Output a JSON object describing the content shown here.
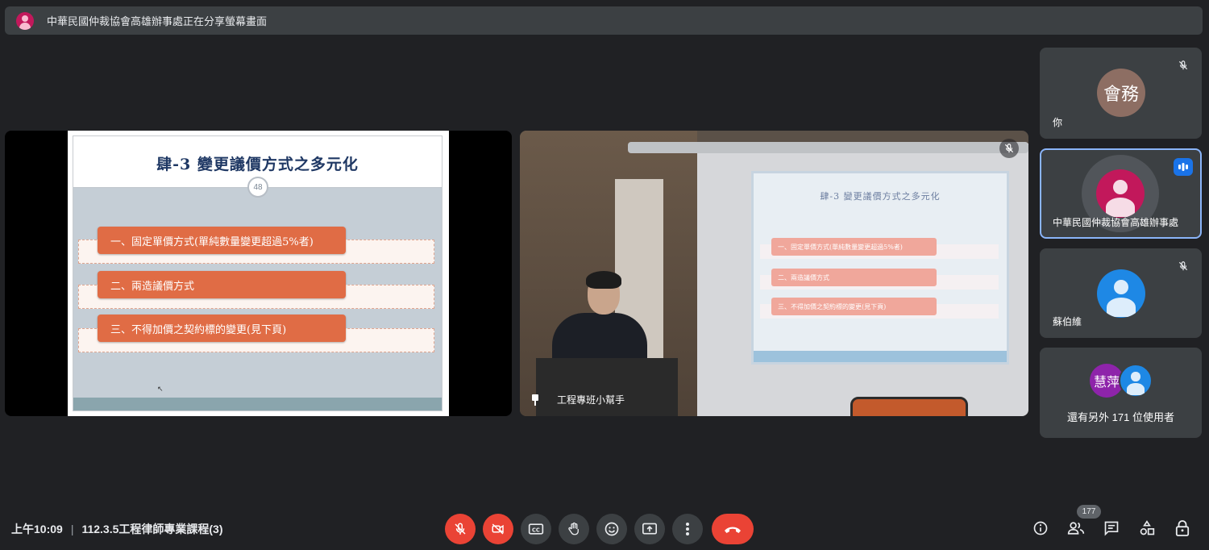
{
  "banner": {
    "text": "中華民國仲裁協會高雄辦事處正在分享螢幕畫面"
  },
  "presentation": {
    "title": "肆-3  變更議價方式之多元化",
    "page_number": "48",
    "items": [
      "一、固定單價方式(單純數量變更超過5%者)",
      "二、兩造議價方式",
      "三、不得加價之契約標的變更(見下頁)"
    ]
  },
  "camera": {
    "name": "工程專班小幫手",
    "projected_title": "肆-3  變更議價方式之多元化",
    "projected_items": [
      "一、固定單價方式(單純數量變更超過5%者)",
      "二、兩造議價方式",
      "三、不得加價之契約標的變更(見下頁)"
    ]
  },
  "participants": [
    {
      "avatar_text": "會務",
      "name": "你",
      "color": "#8d6e63",
      "muted": true
    },
    {
      "name": "中華民國仲裁協會高雄辦事處",
      "color": "#c2185b",
      "speaking": true
    },
    {
      "name": "蘇伯維",
      "color": "#1e88e5",
      "muted": true
    },
    {
      "avatar_text": "慧萍",
      "others_label": "還有另外 171 位使用者",
      "color_a": "#8e24aa",
      "color_b": "#1e88e5"
    }
  ],
  "meeting": {
    "time": "上午10:09",
    "separator": "|",
    "title": "112.3.5工程律師專業課程(3)",
    "people_count": "177"
  },
  "controls": {
    "mic": "mic-off-icon",
    "camera": "camera-off-icon",
    "captions": "captions-icon",
    "hand": "raise-hand-icon",
    "emoji": "emoji-icon",
    "present": "present-screen-icon",
    "more": "more-options-icon",
    "leave": "leave-call-icon"
  },
  "colors": {
    "background": "#202124",
    "tile": "#3c4043",
    "danger": "#ea4335",
    "accent": "#8ab4f8",
    "slide_item": "#e06c45"
  }
}
